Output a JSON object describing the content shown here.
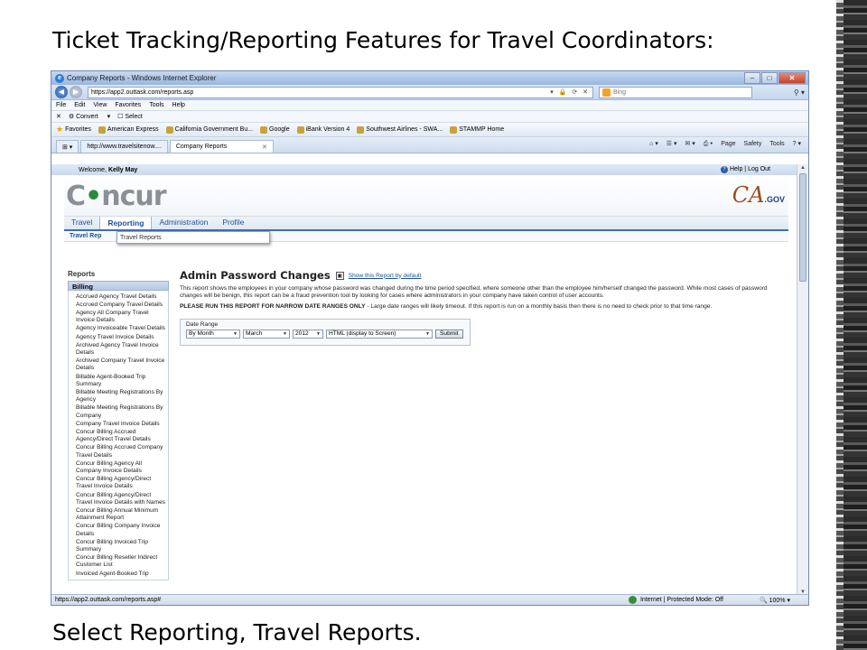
{
  "slide": {
    "title": "Ticket Tracking/Reporting Features for Travel Coordinators:",
    "caption": "Select Reporting, Travel Reports."
  },
  "browser": {
    "window_title": "Company Reports - Windows Internet Explorer",
    "url": "https://app2.outtask.com/reports.asp",
    "search_placeholder": "Bing",
    "menu": [
      "File",
      "Edit",
      "View",
      "Favorites",
      "Tools",
      "Help"
    ],
    "command_bar": [
      "Convert",
      "Select"
    ],
    "favorites_label": "Favorites",
    "favorites": [
      "American Express",
      "California Government Bu...",
      "Google",
      "iBank Version 4",
      "Southwest Airlines - SWA...",
      "STAMMP Home"
    ],
    "tabs": [
      {
        "label": "http://www.travelsitenow...."
      },
      {
        "label": "Company Reports"
      }
    ],
    "tools": [
      "Page",
      "Safety",
      "Tools"
    ],
    "status_url": "https://app2.outtask.com/reports.asp#",
    "status_zone": "Internet | Protected Mode: Off",
    "zoom": "100%"
  },
  "app": {
    "welcome_text": "Welcome,",
    "user_name": "Kelly May",
    "help_label": "Help",
    "logout_label": "Log Out",
    "logo_left": "Concur",
    "logo_right_main": "CA",
    "logo_right_sub": ".GOV",
    "nav": [
      "Travel",
      "Reporting",
      "Administration",
      "Profile"
    ],
    "subnav_label": "Travel Rep",
    "dropdown_item": "Travel Reports",
    "reports_heading": "Reports",
    "billing_heading": "Billing",
    "report_list": [
      "Accrued Agency Travel Details",
      "Accrued Company Travel Details",
      "Agency All Company Travel Invoice Details",
      "Agency Invoiceable Travel Details",
      "Agency Travel Invoice Details",
      "Archived Agency Travel Invoice Details",
      "Archived Company Travel Invoice Details",
      "Billable Agent-Booked Trip Summary",
      "Billable Meeting Registrations By Agency",
      "Billable Meeting Registrations By Company",
      "Company Travel Invoice Details",
      "Concur Billing Accrued Agency/Direct Travel Details",
      "Concur Billing Accrued Company Travel Details",
      "Concur Billing Agency All Company Invoice Details",
      "Concur Billing Agency/Direct Travel Invoice Details",
      "Concur Billing Agency/Direct Travel Invoice Details with Names",
      "Concur Billing Annual Minimum Attainment Report",
      "Concur Billing Company Invoice Details",
      "Concur Billing Invoiced Trip Summary",
      "Concur Billing Reseller Indirect Customer List",
      "Invoiced Agent-Booked Trip"
    ],
    "report_title": "Admin Password Changes",
    "default_link": "Show this Report by default",
    "description": "This report shows the employees in your company whose password was changed during the time period specified, where someone other than the employee him/herself changed the password. While most cases of password changes will be benign, this report can be a fraud prevention tool by looking for cases where administrators in your company have taken control of user accounts.",
    "warning_bold": "PLEASE RUN THIS REPORT FOR NARROW DATE RANGES ONLY",
    "warning_rest": " - Large date ranges will likely timeout. If this report is run on a monthly basis then there is no need to check prior to that time range.",
    "date_range_label": "Date Range",
    "period_value": "By Month",
    "month_value": "March",
    "year_value": "2012",
    "format_value": "HTML (display to Screen)",
    "submit_label": "Submit"
  }
}
